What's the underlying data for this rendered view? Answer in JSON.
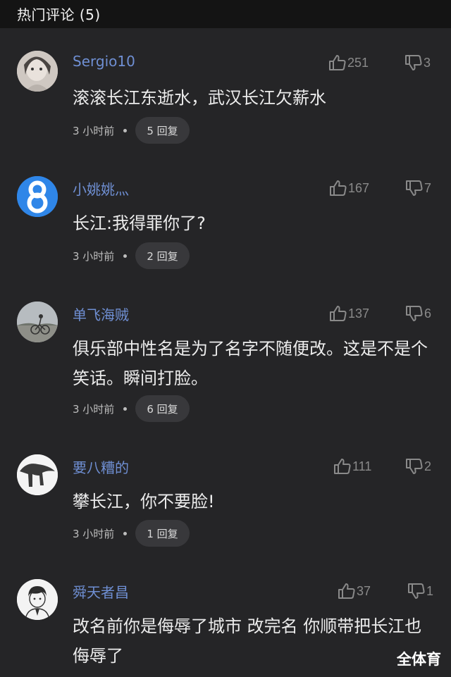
{
  "header": {
    "title": "热门评论 (5)"
  },
  "comments": [
    {
      "username": "Sergio10",
      "likes": "251",
      "dislikes": "3",
      "text": "滚滚长江东逝水，武汉长江欠薪水",
      "time": "3 小时前",
      "replies": "5 回复"
    },
    {
      "username": "小姚姚灬",
      "likes": "167",
      "dislikes": "7",
      "text": "长江:我得罪你了?",
      "time": "3 小时前",
      "replies": "2 回复"
    },
    {
      "username": "单飞海贼",
      "likes": "137",
      "dislikes": "6",
      "text": "俱乐部中性名是为了名字不随便改。这是不是个笑话。瞬间打脸。",
      "time": "3 小时前",
      "replies": "6 回复"
    },
    {
      "username": "要八糟的",
      "likes": "111",
      "dislikes": "2",
      "text": "攀长江，你不要脸!",
      "time": "3 小时前",
      "replies": "1 回复"
    },
    {
      "username": "舜天者昌",
      "likes": "37",
      "dislikes": "1",
      "text": "改名前你是侮辱了城市 改完名 你顺带把长江也侮辱了"
    }
  ],
  "watermark": "全体育"
}
